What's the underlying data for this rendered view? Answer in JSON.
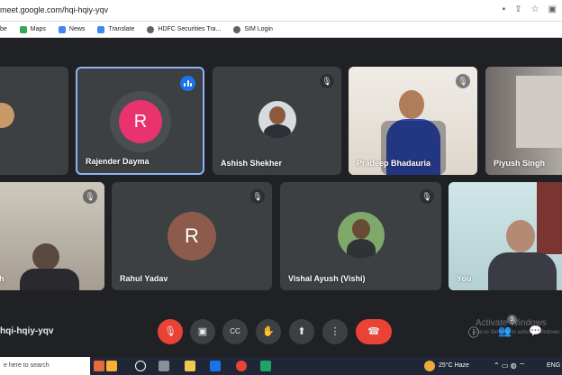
{
  "browser": {
    "url": "meet.google.com/hqi-hqiy-yqv",
    "bookmarks": [
      {
        "label": "be",
        "color": "#9aa0a6"
      },
      {
        "label": "Maps",
        "color": "#34a853"
      },
      {
        "label": "News",
        "color": "#4285f4"
      },
      {
        "label": "Translate",
        "color": "#4285f4"
      },
      {
        "label": "HDFC Securities Tra...",
        "color": "#202124"
      },
      {
        "label": "SIM Login",
        "color": "#202124"
      }
    ]
  },
  "meeting": {
    "code": "hqi-hqiy-yqv",
    "participant_count": "9",
    "participants": [
      {
        "name": "Rajender Dayma",
        "initial": "R",
        "speaking": true
      },
      {
        "name": "Ashish Shekher"
      },
      {
        "name": "Pradeep Bhadauria"
      },
      {
        "name": "Piyush Singh"
      },
      {
        "name": "h"
      },
      {
        "name": "Rahul Yadav",
        "initial": "R"
      },
      {
        "name": "Vishal Ayush (Vishi)"
      },
      {
        "name": "You"
      }
    ],
    "controls": [
      "mic-off",
      "camera",
      "captions",
      "raise-hand",
      "present",
      "more",
      "end-call"
    ],
    "watermark_title": "Activate Windows",
    "watermark_sub": "Go to Settings to activate Windows."
  },
  "taskbar": {
    "search_placeholder": "e here to search",
    "weather": "25°C  Haze",
    "lang": "ENG"
  },
  "colors": {
    "accent": "#8ab4f8",
    "speaking": "#1a73e8",
    "end_call": "#ea4335",
    "avatar_rajender": "#e8336f",
    "avatar_rahul": "#8d5b4c"
  }
}
